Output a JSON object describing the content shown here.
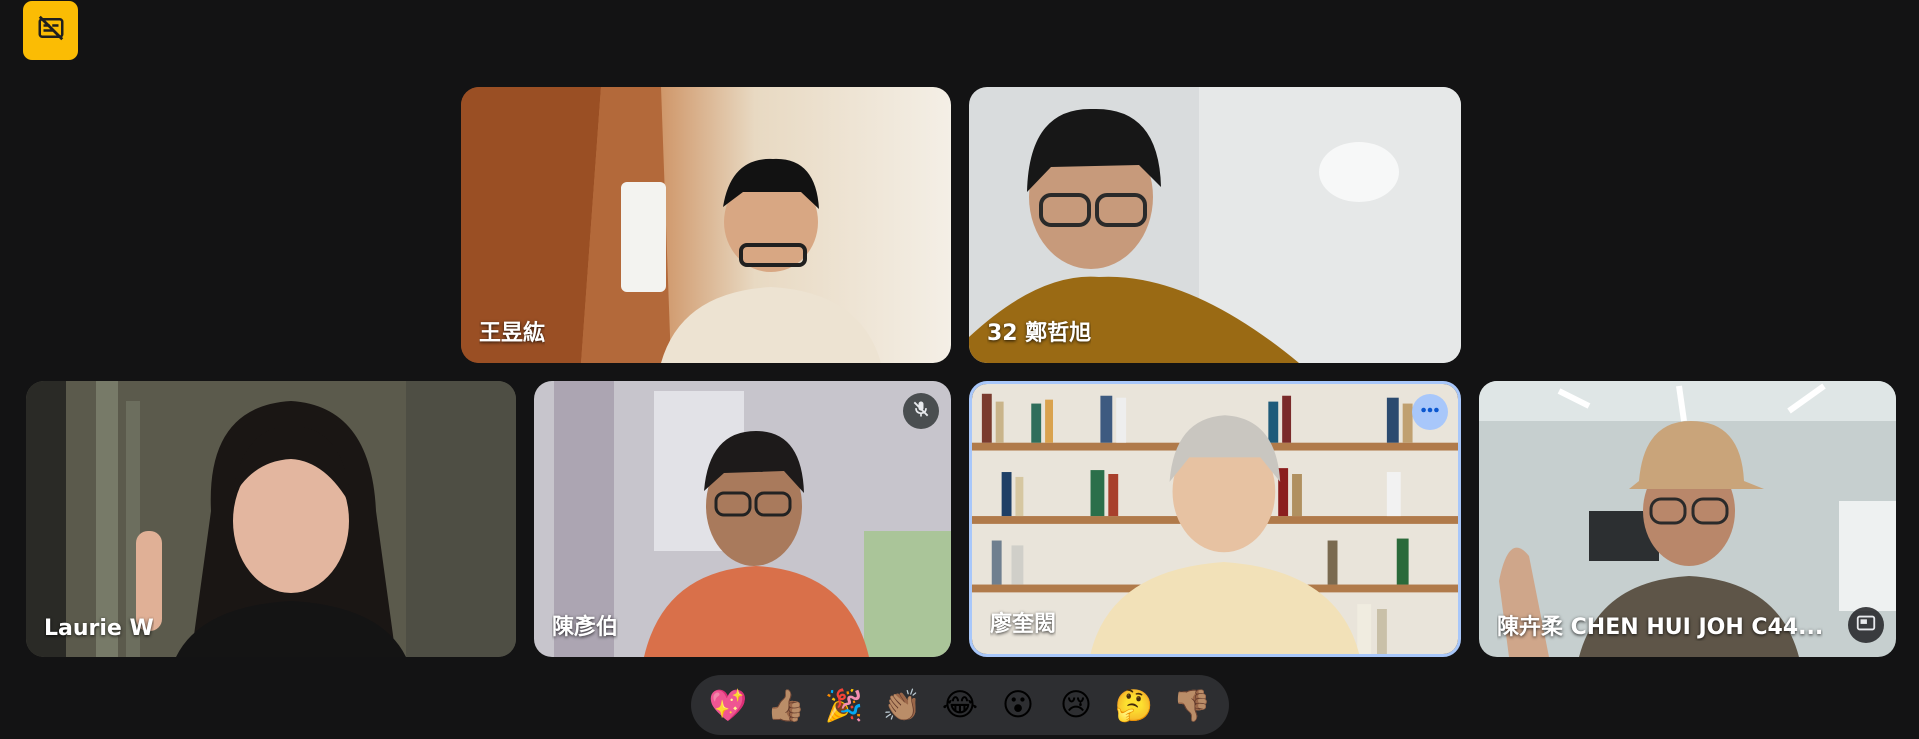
{
  "colors": {
    "background": "#131314",
    "accent_yellow": "#fbbc04",
    "active_border": "#a8c7fa",
    "reaction_bar": "#2d2e31"
  },
  "top_button": {
    "icon": "captions-off-icon"
  },
  "participants": [
    {
      "name": "王昱紘",
      "muted": false,
      "active": false
    },
    {
      "name": "32 鄭哲旭",
      "muted": false,
      "active": false
    },
    {
      "name": "Laurie W",
      "muted": false,
      "active": false
    },
    {
      "name": "陳彥伯",
      "muted": true,
      "active": false
    },
    {
      "name": "廖奎閎",
      "muted": false,
      "active": true,
      "menu_icon": "more-horiz-icon"
    },
    {
      "name": "陳卉柔 CHEN HUI JOH C44...",
      "muted": false,
      "active": false,
      "pip_icon": "picture-in-picture-icon"
    }
  ],
  "reactions": [
    {
      "emoji": "💖",
      "icon": "sparkling-heart-icon"
    },
    {
      "emoji": "👍🏽",
      "icon": "thumbs-up-icon"
    },
    {
      "emoji": "🎉",
      "icon": "party-popper-icon"
    },
    {
      "emoji": "👏🏽",
      "icon": "clapping-hands-icon"
    },
    {
      "emoji": "😂",
      "icon": "tears-of-joy-icon"
    },
    {
      "emoji": "😮",
      "icon": "open-mouth-icon"
    },
    {
      "emoji": "😢",
      "icon": "crying-face-icon"
    },
    {
      "emoji": "🤔",
      "icon": "thinking-face-icon"
    },
    {
      "emoji": "👎🏽",
      "icon": "thumbs-down-icon"
    }
  ]
}
